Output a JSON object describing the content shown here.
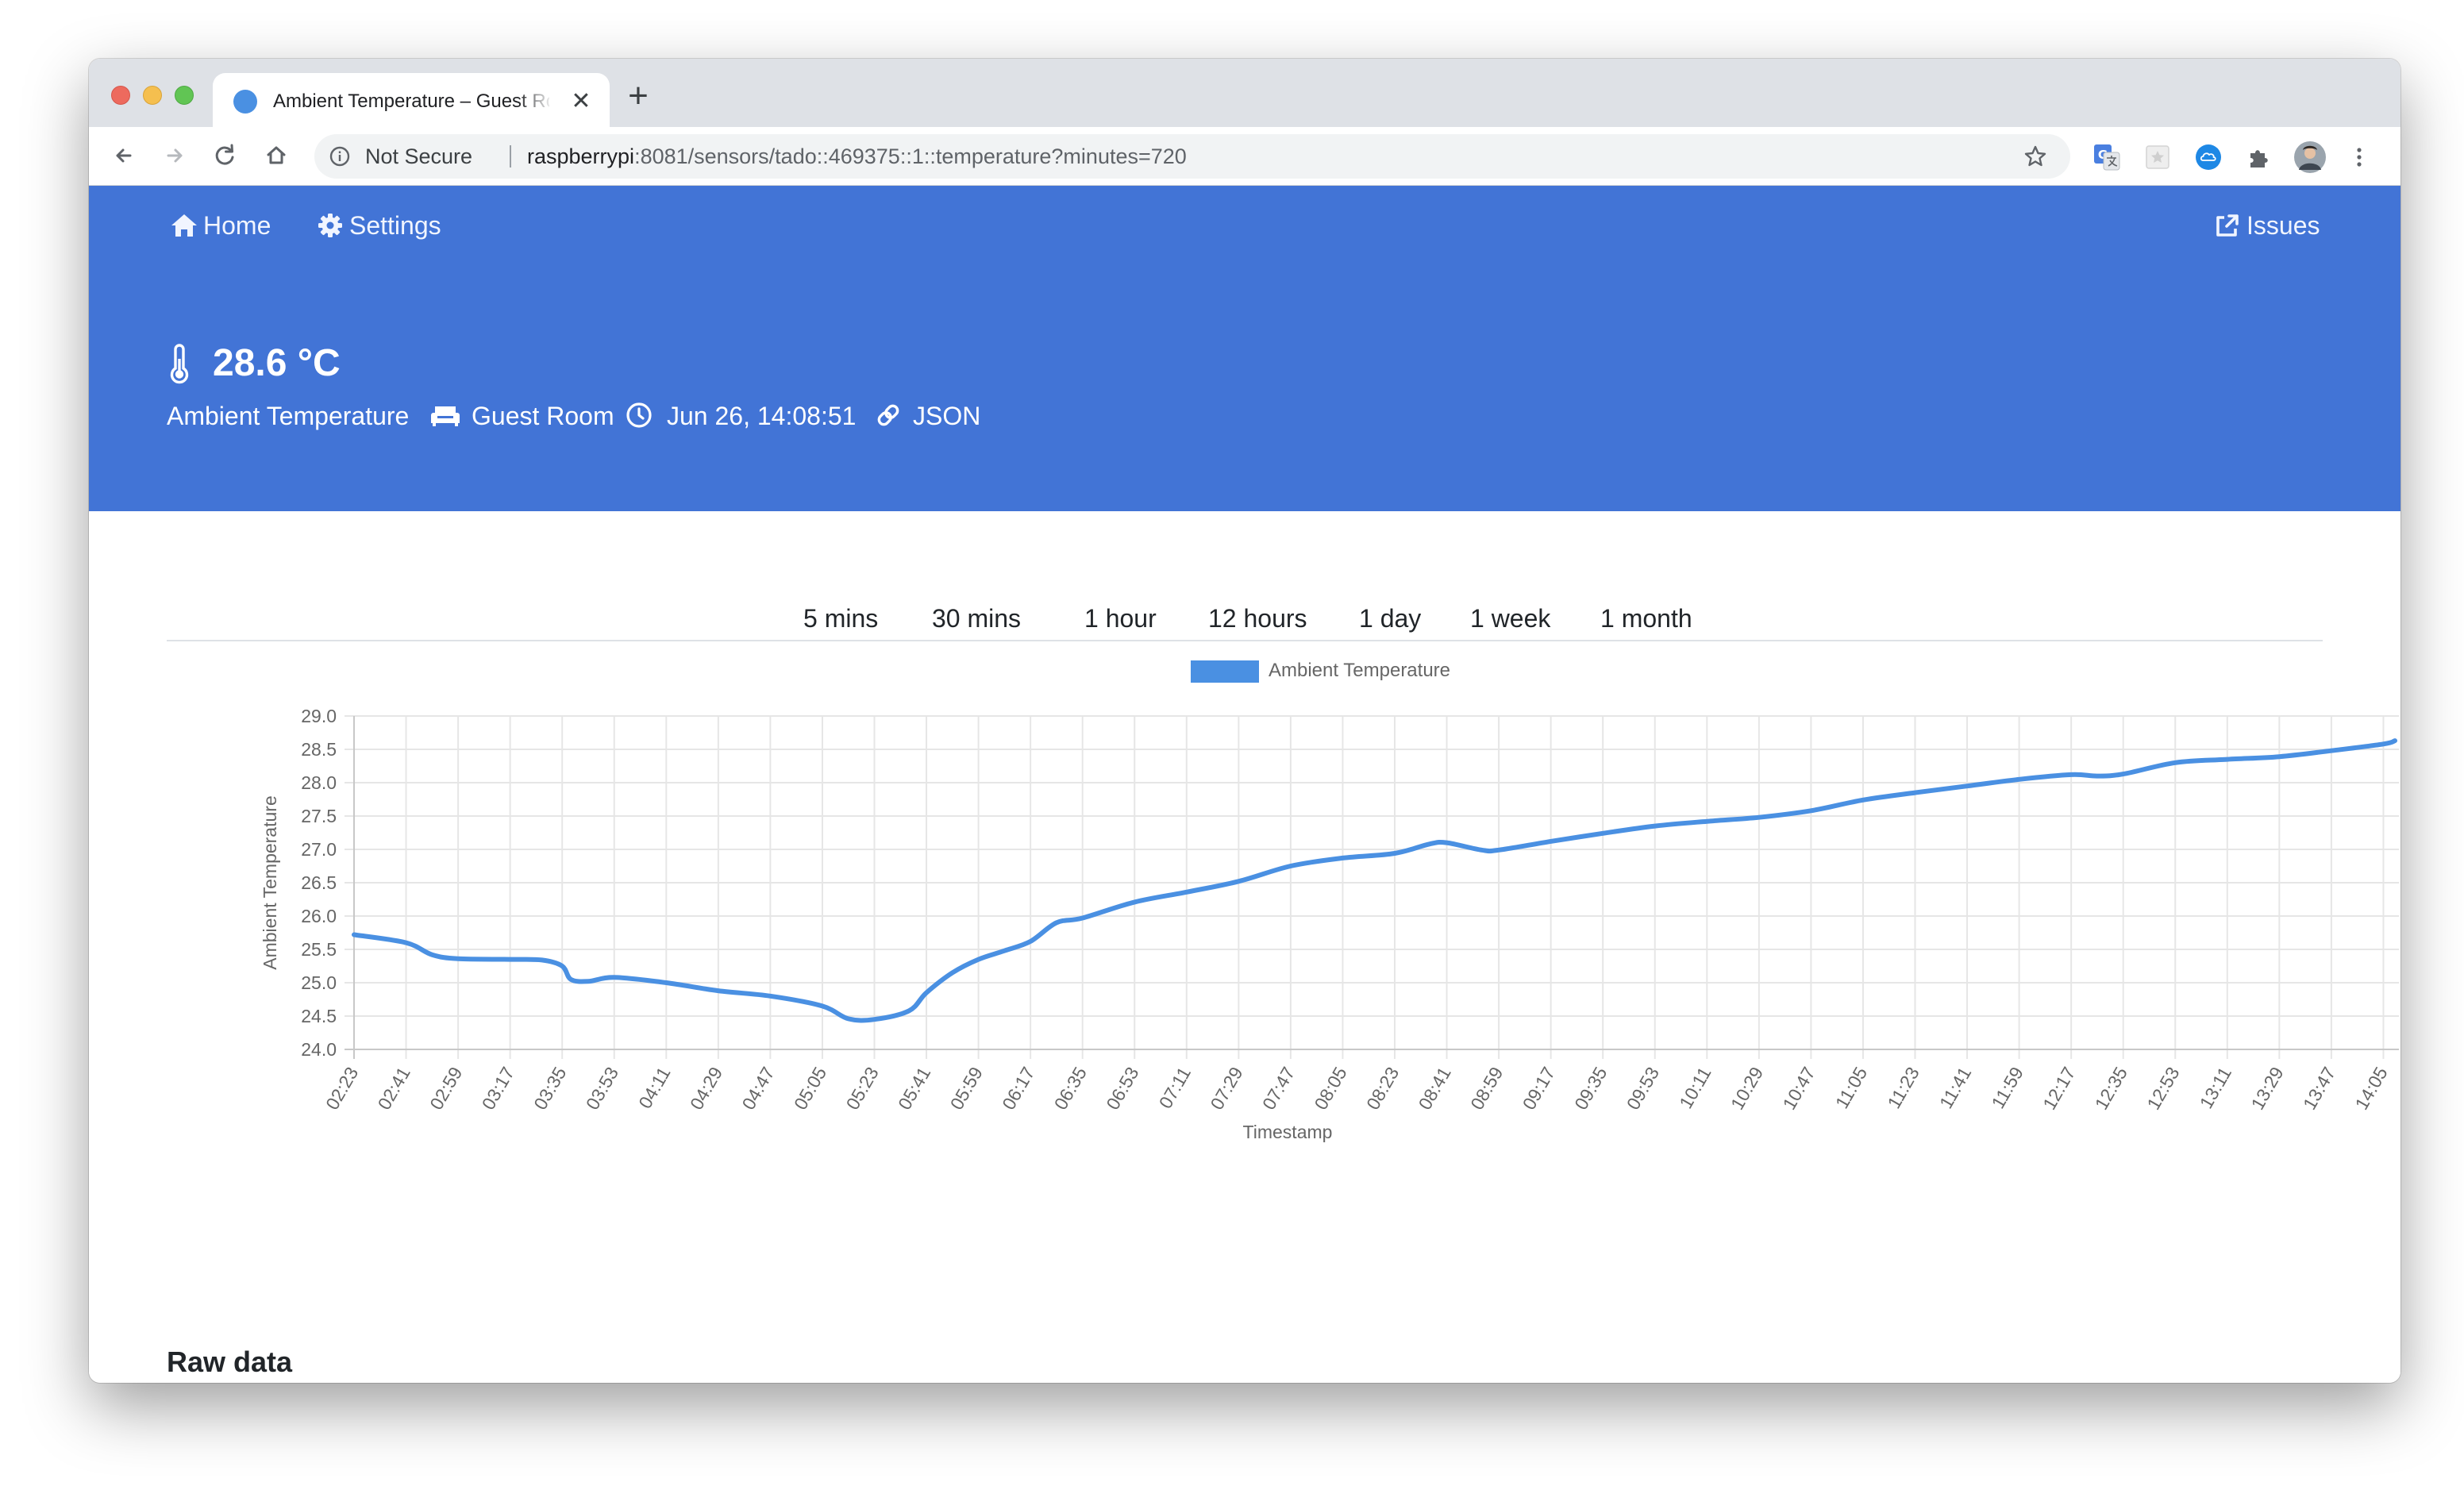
{
  "browser": {
    "tab_title": "Ambient Temperature – Guest Room",
    "tab_close": "✕",
    "new_tab": "+",
    "security_label": "Not Secure",
    "url_host": "raspberrypi",
    "url_rest": ":8081/sensors/tado::469375::1::temperature?minutes=720"
  },
  "nav": {
    "home": "Home",
    "settings": "Settings",
    "issues": "Issues"
  },
  "header": {
    "value": "28.6 °C",
    "sensor_name": "Ambient Temperature",
    "room": "Guest Room",
    "timestamp": "Jun 26, 14:08:51",
    "json_link": "JSON"
  },
  "ranges": [
    "5 mins",
    "30 mins",
    "1 hour",
    "12 hours",
    "1 day",
    "1 week",
    "1 month"
  ],
  "raw_data_title": "Raw data",
  "chart_data": {
    "type": "line",
    "xlabel": "Timestamp",
    "ylabel": "Ambient Temperature",
    "ylim": [
      24.0,
      29.0
    ],
    "y_ticks": [
      "29.0",
      "28.5",
      "28.0",
      "27.5",
      "27.0",
      "26.5",
      "26.0",
      "25.5",
      "25.0",
      "24.5",
      "24.0"
    ],
    "grid": true,
    "legend_position": "top",
    "categories": [
      "02:23",
      "02:41",
      "02:59",
      "03:17",
      "03:35",
      "03:53",
      "04:11",
      "04:29",
      "04:47",
      "05:05",
      "05:23",
      "05:41",
      "05:59",
      "06:17",
      "06:35",
      "06:53",
      "07:11",
      "07:29",
      "07:47",
      "08:05",
      "08:23",
      "08:41",
      "08:59",
      "09:17",
      "09:35",
      "09:53",
      "10:11",
      "10:29",
      "10:47",
      "11:05",
      "11:23",
      "11:41",
      "11:59",
      "12:17",
      "12:35",
      "12:53",
      "13:11",
      "13:29",
      "13:47",
      "14:05"
    ],
    "series": [
      {
        "name": "Ambient Temperature",
        "color": "#4a90e2",
        "points": [
          [
            "02:23",
            25.72
          ],
          [
            "02:41",
            25.6
          ],
          [
            "02:50",
            25.42
          ],
          [
            "02:59",
            25.36
          ],
          [
            "03:17",
            25.35
          ],
          [
            "03:28",
            25.34
          ],
          [
            "03:35",
            25.25
          ],
          [
            "03:38",
            25.05
          ],
          [
            "03:44",
            25.02
          ],
          [
            "03:53",
            25.08
          ],
          [
            "04:11",
            25.0
          ],
          [
            "04:29",
            24.88
          ],
          [
            "04:47",
            24.8
          ],
          [
            "05:05",
            24.65
          ],
          [
            "05:14",
            24.46
          ],
          [
            "05:23",
            24.45
          ],
          [
            "05:35",
            24.58
          ],
          [
            "05:41",
            24.85
          ],
          [
            "05:50",
            25.15
          ],
          [
            "05:59",
            25.35
          ],
          [
            "06:08",
            25.48
          ],
          [
            "06:17",
            25.62
          ],
          [
            "06:26",
            25.9
          ],
          [
            "06:35",
            25.97
          ],
          [
            "06:53",
            26.21
          ],
          [
            "07:11",
            26.36
          ],
          [
            "07:29",
            26.52
          ],
          [
            "07:47",
            26.75
          ],
          [
            "08:05",
            26.87
          ],
          [
            "08:23",
            26.94
          ],
          [
            "08:35",
            27.08
          ],
          [
            "08:41",
            27.1
          ],
          [
            "08:53",
            26.99
          ],
          [
            "08:59",
            26.99
          ],
          [
            "09:17",
            27.12
          ],
          [
            "09:35",
            27.24
          ],
          [
            "09:53",
            27.35
          ],
          [
            "10:11",
            27.42
          ],
          [
            "10:29",
            27.48
          ],
          [
            "10:47",
            27.58
          ],
          [
            "11:05",
            27.74
          ],
          [
            "11:23",
            27.85
          ],
          [
            "11:41",
            27.95
          ],
          [
            "11:59",
            28.05
          ],
          [
            "12:17",
            28.12
          ],
          [
            "12:26",
            28.1
          ],
          [
            "12:35",
            28.13
          ],
          [
            "12:53",
            28.3
          ],
          [
            "13:11",
            28.35
          ],
          [
            "13:29",
            28.39
          ],
          [
            "13:47",
            28.48
          ],
          [
            "14:05",
            28.58
          ],
          [
            "14:09",
            28.63
          ]
        ]
      }
    ]
  }
}
